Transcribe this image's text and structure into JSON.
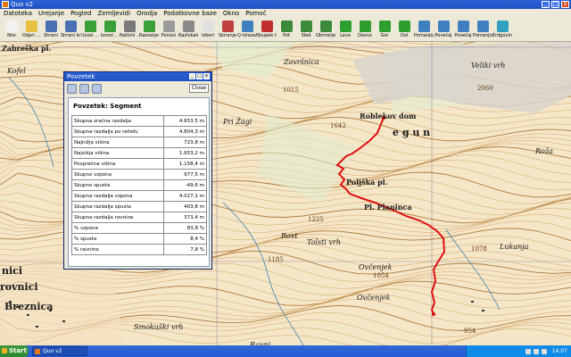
{
  "window": {
    "title": "Quo v2"
  },
  "menu": [
    "Datoteka",
    "Urejanje",
    "Pogled",
    "Zemljevidi",
    "Orodja",
    "Podatkovne baze",
    "Okno",
    "Pomoč"
  ],
  "toolbar": [
    {
      "label": "Nov",
      "icon": "new-file-icon",
      "color": "#f2f2f2"
    },
    {
      "label": "Odpri ...",
      "icon": "open-folder-icon",
      "color": "#e8c040"
    },
    {
      "label": "Shrani",
      "icon": "save-icon",
      "color": "#4a6fb5"
    },
    {
      "label": "Shrani kot ...",
      "icon": "save-as-icon",
      "color": "#4a6fb5"
    },
    {
      "label": "Uvozi ...",
      "icon": "import-icon",
      "color": "#3aa03a"
    },
    {
      "label": "Izvozi ...",
      "icon": "export-icon",
      "color": "#3aa03a"
    },
    {
      "label": "Natisni ...",
      "icon": "print-icon",
      "color": "#7a7a7a"
    },
    {
      "label": "Razveljavi",
      "icon": "undo-icon",
      "color": "#3aa03a"
    },
    {
      "label": "Ponovi",
      "icon": "redo-icon",
      "color": "#9a9a9a"
    },
    {
      "label": "Razlokalen",
      "icon": "pan-icon",
      "color": "#8a8a8a"
    },
    {
      "label": "Izberi",
      "icon": "select-icon",
      "color": "#e0e0e0"
    },
    {
      "label": "Skiranje",
      "icon": "draw-icon",
      "color": "#c04040"
    },
    {
      "label": "Q-Izrezatek",
      "icon": "clip-icon",
      "color": "#4080c0"
    },
    {
      "label": "Skupek točk",
      "icon": "waypoints-icon",
      "color": "#c03030"
    },
    {
      "label": "Pot",
      "icon": "route-icon",
      "color": "#3a8a3a"
    },
    {
      "label": "Sled",
      "icon": "track-icon",
      "color": "#3a8a3a"
    },
    {
      "label": "Območje",
      "icon": "area-icon",
      "color": "#3a8a3a"
    },
    {
      "label": "Levo",
      "icon": "arrow-left-icon",
      "color": "#2e9e2e"
    },
    {
      "label": "Desno",
      "icon": "arrow-right-icon",
      "color": "#2e9e2e"
    },
    {
      "label": "Gor",
      "icon": "arrow-up-icon",
      "color": "#2e9e2e"
    },
    {
      "label": "Dol",
      "icon": "arrow-down-icon",
      "color": "#2e9e2e"
    },
    {
      "label": "Pomanjšaj",
      "icon": "zoom-out-icon",
      "color": "#4080c0"
    },
    {
      "label": "Povečaj",
      "icon": "zoom-in-icon",
      "color": "#4080c0"
    },
    {
      "label": "Povečaj",
      "icon": "zoom-in-2-icon",
      "color": "#4080c0"
    },
    {
      "label": "Pomanjšaj",
      "icon": "zoom-out-2-icon",
      "color": "#4080c0"
    },
    {
      "label": "Erdgovina ...",
      "icon": "globe-icon",
      "color": "#30a0c0"
    }
  ],
  "panel": {
    "title": "Povzetek",
    "close_label": "Close",
    "heading": "Povzetek: Segment",
    "rows": [
      {
        "label": "Skupna zračna razdalja",
        "value": "4.653,5 m"
      },
      {
        "label": "Skupna razdalja po reliefu",
        "value": "4.804,3 m"
      },
      {
        "label": "Najnižja višina",
        "value": "723,8 m"
      },
      {
        "label": "Najvišja višina",
        "value": "1.653,2 m"
      },
      {
        "label": "Povprečna višina",
        "value": "1.158,4 m"
      },
      {
        "label": "Skupno vzpona",
        "value": "977,5 m"
      },
      {
        "label": "Skupno spusta",
        "value": "-49,6 m"
      },
      {
        "label": "Skupna razdalja vzpona",
        "value": "4.027,1 m"
      },
      {
        "label": "Skupna razdalja spusta",
        "value": "403,8 m"
      },
      {
        "label": "Skupna razdalja ravnine",
        "value": "373,4 m"
      },
      {
        "label": "% vzpona",
        "value": "83,8 %"
      },
      {
        "label": "% spusta",
        "value": "8,4 %"
      },
      {
        "label": "% ravnine",
        "value": "7,8 %"
      }
    ]
  },
  "map": {
    "labels": [
      {
        "text": "Zabreška pl.",
        "cls": "mid"
      },
      {
        "text": "Kofel",
        "cls": "ital"
      },
      {
        "text": "Završnica",
        "cls": "ital"
      },
      {
        "text": "1015",
        "cls": "sm"
      },
      {
        "text": "Roblekov dom",
        "cls": "mid"
      },
      {
        "text": "1642",
        "cls": "sm"
      },
      {
        "text": "Veliki vrh",
        "cls": "ital"
      },
      {
        "text": "2060",
        "cls": "sm"
      },
      {
        "text": "Pri Žagi",
        "cls": "ital"
      },
      {
        "text": "Poljška pl.",
        "cls": "mid"
      },
      {
        "text": "Pl. Planinca",
        "cls": "mid"
      },
      {
        "text": "Tolsti vrh",
        "cls": "ital"
      },
      {
        "text": "1225",
        "cls": "sm"
      },
      {
        "text": "Rovt",
        "cls": "ital"
      },
      {
        "text": "1185",
        "cls": "sm"
      },
      {
        "text": "1078",
        "cls": "sm"
      },
      {
        "text": "Ovčenjek",
        "cls": "ital"
      },
      {
        "text": "1054",
        "cls": "sm"
      },
      {
        "text": "Ovčenjek",
        "cls": "ital"
      },
      {
        "text": "nici",
        "cls": "big"
      },
      {
        "text": "rovnici",
        "cls": "big"
      },
      {
        "text": "Breznica",
        "cls": "big"
      },
      {
        "text": "Smokuški vrh",
        "cls": "ital"
      },
      {
        "text": "954",
        "cls": "sm"
      },
      {
        "text": "Roža",
        "cls": "ital"
      },
      {
        "text": "Lukanja",
        "cls": "ital"
      },
      {
        "text": "Ravni",
        "cls": "ital"
      },
      {
        "text": "e g u n",
        "cls": "big"
      }
    ]
  },
  "taskbar": {
    "start_label": "Start",
    "task_label": "Quo v2",
    "clock": "14:07"
  }
}
